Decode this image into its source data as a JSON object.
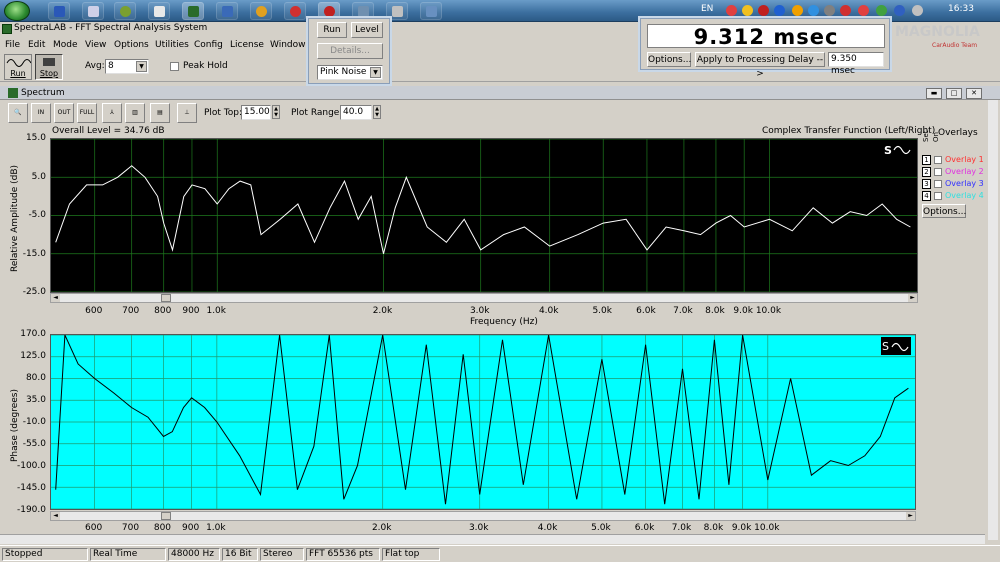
{
  "taskbar": {
    "lang": "EN",
    "clock": "16:33",
    "app_icons": [
      "save-icon",
      "calculator-icon",
      "game-icon",
      "spectralab-icon",
      "floppy-icon",
      "browser-icon",
      "record-icon",
      "record-red-icon",
      "monitor-icon",
      "sound-icon",
      "window-icon"
    ],
    "tray_colors": [
      "#e04040",
      "#f0c020",
      "#c02020",
      "#2060d0",
      "#f0a000",
      "#3090e0",
      "#808080",
      "#d03030",
      "#e04040",
      "#40a040",
      "#3060c0",
      "#c0c0c0"
    ]
  },
  "app": {
    "title": "SpectraLAB - FFT Spectral Analysis System",
    "menu": [
      "File",
      "Edit",
      "Mode",
      "View",
      "Options",
      "Utilities",
      "Config",
      "License",
      "Window"
    ]
  },
  "toolbar": {
    "run_label": "Run",
    "stop_label": "Stop",
    "avg_label": "Avg:",
    "avg_value": "8",
    "peak_hold_label": "Peak Hold"
  },
  "generator": {
    "run_label": "Run",
    "level_label": "Level",
    "details_label": "Details...",
    "signal_value": "Pink Noise"
  },
  "delay": {
    "display": "9.312 msec",
    "options_label": "Options...",
    "apply_label": "Apply to Processing Delay -->",
    "applied_value": "9.350 msec"
  },
  "watermark": {
    "brand": "MAGNOLIA",
    "team": "CarAudio Team"
  },
  "spectrum_window": {
    "title": "Spectrum",
    "plot_top_label": "Plot Top:",
    "plot_top_value": "15.00",
    "plot_range_label": "Plot Range:",
    "plot_range_value": "40.0",
    "overall_level": "Overall Level = 34.76 dB",
    "transfer_label": "Complex Transfer Function (Left/Right)",
    "overlays_title": "Overlays",
    "set_label": "Set",
    "on_label": "On",
    "overlays": [
      {
        "num": "1",
        "label": "Overlay 1",
        "color": "#ff3030"
      },
      {
        "num": "2",
        "label": "Overlay 2",
        "color": "#e030e0"
      },
      {
        "num": "3",
        "label": "Overlay 3",
        "color": "#3030ff"
      },
      {
        "num": "4",
        "label": "Overlay 4",
        "color": "#30e0e0"
      }
    ],
    "options_label": "Options...",
    "xlabel": "Frequency (Hz)",
    "xticks": [
      "600",
      "700",
      "800",
      "900",
      "1.0k",
      "2.0k",
      "3.0k",
      "4.0k",
      "5.0k",
      "6.0k",
      "7.0k",
      "8.0k",
      "9.0k",
      "10.0k"
    ]
  },
  "chart_data": [
    {
      "type": "line",
      "title": "",
      "ylabel": "Relative Amplitude (dB)",
      "xlabel": "Frequency (Hz)",
      "ylim": [
        -25,
        15
      ],
      "yticks": [
        "15.0",
        "5.0",
        "-5.0",
        "-15.0",
        "-25.0"
      ],
      "xscale": "log",
      "grid": true,
      "background": "#000000",
      "line_color": "#ffffff",
      "series": [
        {
          "x": [
            510,
            540,
            580,
            620,
            660,
            700,
            740,
            780,
            800,
            830,
            870,
            900,
            950,
            1000,
            1050,
            1100,
            1150,
            1200,
            1300,
            1400,
            1500,
            1600,
            1700,
            1800,
            1900,
            2000,
            2100,
            2200,
            2400,
            2600,
            2800,
            3000,
            3300,
            3600,
            4000,
            4500,
            5000,
            5500,
            6000,
            6500,
            7000,
            7500,
            8000,
            8500,
            9000,
            10000,
            11000,
            12000,
            13000,
            14000,
            15000,
            16000,
            17000,
            18000
          ],
          "y": [
            -12,
            -2,
            3,
            3,
            5,
            8,
            5,
            0,
            -7,
            -14,
            0,
            3,
            2,
            -2,
            2,
            4,
            3,
            -10,
            -6,
            -2,
            -12,
            -3,
            4,
            -6,
            0,
            -15,
            -3,
            5,
            -8,
            -12,
            -6,
            -14,
            -10,
            -8,
            -13,
            -10,
            -7,
            -6,
            -14,
            -8,
            -9,
            -10,
            -7,
            -5,
            -8,
            -6,
            -9,
            -3,
            -7,
            -4,
            -5,
            -2,
            -6,
            -8
          ]
        }
      ]
    },
    {
      "type": "line",
      "title": "",
      "ylabel": "Phase (degrees)",
      "xlabel": "",
      "ylim": [
        -190,
        170
      ],
      "yticks": [
        "170.0",
        "125.0",
        "80.0",
        "35.0",
        "-10.0",
        "-55.0",
        "-100.0",
        "-145.0",
        "-190.0"
      ],
      "xscale": "log",
      "grid": true,
      "background": "#00ffff",
      "line_color": "#000000",
      "series": [
        {
          "x": [
            510,
            530,
            560,
            600,
            650,
            700,
            750,
            800,
            830,
            870,
            900,
            950,
            1000,
            1100,
            1200,
            1300,
            1400,
            1500,
            1600,
            1700,
            1800,
            2000,
            2200,
            2400,
            2600,
            2800,
            3000,
            3300,
            3600,
            4000,
            4500,
            5000,
            5500,
            6000,
            6500,
            7000,
            7500,
            8000,
            8500,
            9000,
            10000,
            11000,
            12000,
            13000,
            14000,
            15000,
            16000,
            17000,
            18000
          ],
          "y": [
            -150,
            170,
            110,
            80,
            50,
            20,
            0,
            -40,
            -30,
            20,
            40,
            20,
            -10,
            -80,
            -160,
            170,
            -150,
            -60,
            170,
            -170,
            -100,
            170,
            -150,
            150,
            -180,
            130,
            -160,
            160,
            -140,
            170,
            -170,
            120,
            -160,
            150,
            -180,
            100,
            -170,
            160,
            -140,
            170,
            -130,
            80,
            -120,
            -90,
            -100,
            -80,
            -40,
            40,
            60
          ]
        }
      ]
    }
  ],
  "phase_xticks": [
    "600",
    "700",
    "800",
    "900",
    "1.0k",
    "2.0k",
    "3.0k",
    "4.0k",
    "5.0k",
    "6.0k",
    "7.0k",
    "8.0k",
    "9.0k",
    "10.0k"
  ],
  "statusbar": {
    "state": "Stopped",
    "mode": "Real Time",
    "rate": "48000 Hz",
    "bits": "16 Bit",
    "channels": "Stereo",
    "fft": "FFT 65536 pts",
    "window": "Flat top"
  }
}
